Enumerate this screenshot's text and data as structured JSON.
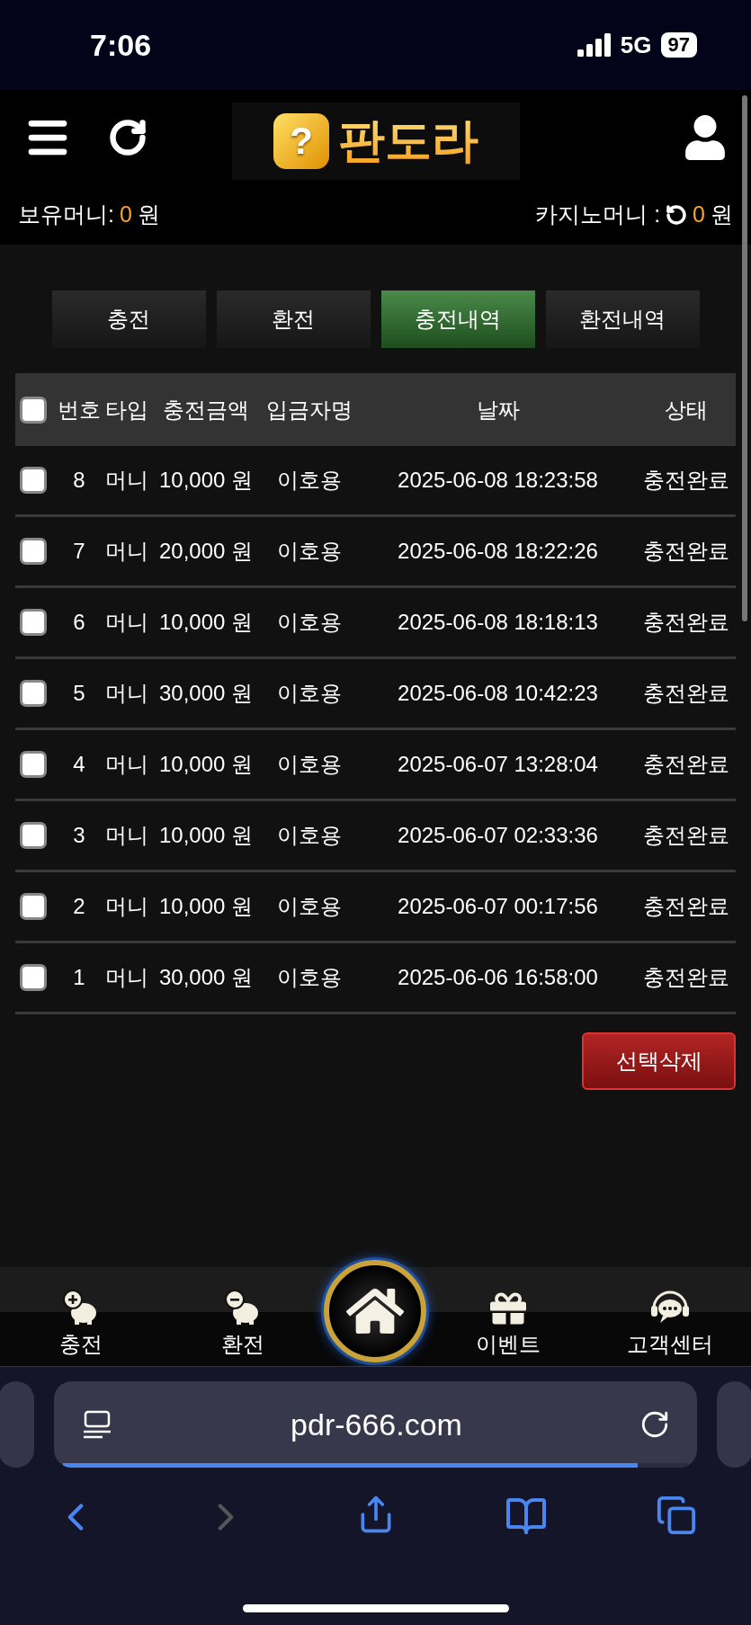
{
  "status_bar": {
    "time": "7:06",
    "network": "5G",
    "battery": "97"
  },
  "header": {
    "logo_mark": "?",
    "logo_text": "판도라"
  },
  "balances": [
    {
      "label": "보유머니:",
      "amount": "0",
      "unit": "원",
      "refresh": false
    },
    {
      "label": "카지노머니 :",
      "amount": "0",
      "unit": "원",
      "refresh": true
    }
  ],
  "tabs": [
    {
      "label": "충전",
      "selected": false
    },
    {
      "label": "환전",
      "selected": false
    },
    {
      "label": "충전내역",
      "selected": true
    },
    {
      "label": "환전내역",
      "selected": false
    }
  ],
  "table": {
    "select_all": false,
    "columns": [
      "번호",
      "타입",
      "충전금액",
      "입금자명",
      "날짜",
      "상태"
    ],
    "rows": [
      {
        "checked": false,
        "cells": [
          "8",
          "머니",
          "10,000 원",
          "이호용",
          "2025-06-08 18:23:58",
          "충전완료"
        ]
      },
      {
        "checked": false,
        "cells": [
          "7",
          "머니",
          "20,000 원",
          "이호용",
          "2025-06-08 18:22:26",
          "충전완료"
        ]
      },
      {
        "checked": false,
        "cells": [
          "6",
          "머니",
          "10,000 원",
          "이호용",
          "2025-06-08 18:18:13",
          "충전완료"
        ]
      },
      {
        "checked": false,
        "cells": [
          "5",
          "머니",
          "30,000 원",
          "이호용",
          "2025-06-08 10:42:23",
          "충전완료"
        ]
      },
      {
        "checked": false,
        "cells": [
          "4",
          "머니",
          "10,000 원",
          "이호용",
          "2025-06-07 13:28:04",
          "충전완료"
        ]
      },
      {
        "checked": false,
        "cells": [
          "3",
          "머니",
          "10,000 원",
          "이호용",
          "2025-06-07 02:33:36",
          "충전완료"
        ]
      },
      {
        "checked": false,
        "cells": [
          "2",
          "머니",
          "10,000 원",
          "이호용",
          "2025-06-07 00:17:56",
          "충전완료"
        ]
      },
      {
        "checked": false,
        "cells": [
          "1",
          "머니",
          "30,000 원",
          "이호용",
          "2025-06-06 16:58:00",
          "충전완료"
        ]
      }
    ]
  },
  "delete_button": "선택삭제",
  "bottom_nav": [
    {
      "kind": "link",
      "label": "충전"
    },
    {
      "kind": "link",
      "label": "환전"
    },
    {
      "kind": "home"
    },
    {
      "kind": "link",
      "label": "이벤트"
    },
    {
      "kind": "link",
      "label": "고객센터"
    }
  ],
  "browser": {
    "url": "pdr-666.com",
    "level": 0.92,
    "back_disabled": false,
    "forward_disabled": true
  }
}
